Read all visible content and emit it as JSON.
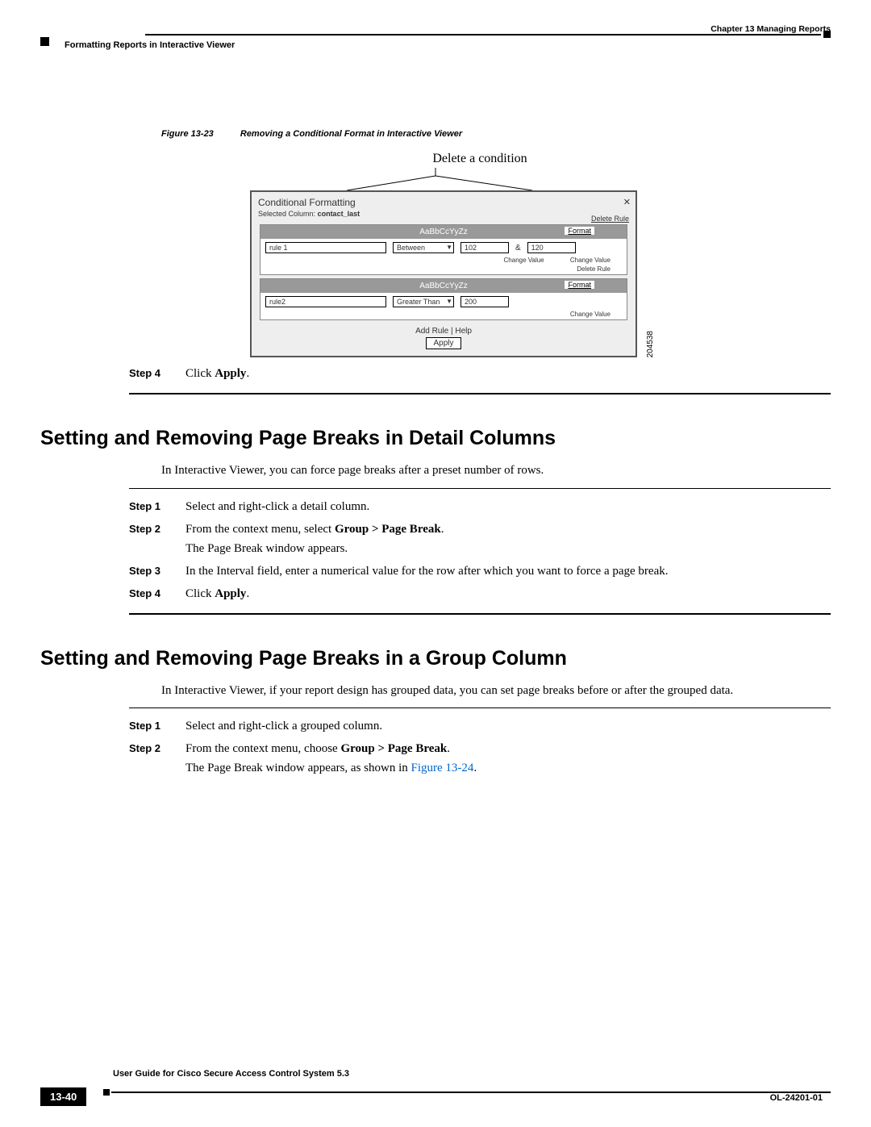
{
  "header": {
    "chapter": "Chapter 13      Managing Reports",
    "section_title": "Formatting Reports in Interactive Viewer"
  },
  "figure": {
    "number": "Figure 13-23",
    "title": "Removing a Conditional Format in Interactive Viewer",
    "callout": "Delete a condition",
    "image_id": "204538"
  },
  "dialog": {
    "title": "Conditional Formatting",
    "selected_label": "Selected Column:",
    "selected_value": "contact_last",
    "close_x": "✕",
    "delete_rule": "Delete Rule",
    "format": "Format",
    "rule1": {
      "header": "AaBbCcYyZz",
      "valueA": "rule 1",
      "op": "Between",
      "v1": "102",
      "amp": "&",
      "v2": "120",
      "cv1": "Change Value",
      "cv2": "Change Value",
      "del": "Delete Rule"
    },
    "rule2": {
      "header": "AaBbCcYyZz",
      "valueA": "rule2",
      "op": "Greater Than",
      "v1": "200",
      "cv1": "Change Value"
    },
    "footer_links": "Add Rule  |  Help",
    "apply": "Apply"
  },
  "step4_single": {
    "label": "Step 4",
    "text_a": "Click ",
    "text_b": "Apply",
    "text_c": "."
  },
  "section1": {
    "heading": "Setting and Removing Page Breaks in Detail Columns",
    "intro": "In Interactive Viewer, you can force page breaks after a preset number of rows.",
    "steps": [
      {
        "label": "Step 1",
        "text": "Select and right-click a detail column."
      },
      {
        "label": "Step 2",
        "text_a": "From the context menu, select ",
        "text_b": "Group > Page Break",
        "after": "The Page Break window appears."
      },
      {
        "label": "Step 3",
        "text": "In the Interval field, enter a numerical value for the row after which you want to force a page break."
      },
      {
        "label": "Step 4",
        "text_a": "Click ",
        "text_b": "Apply",
        "text_c": "."
      }
    ]
  },
  "section2": {
    "heading": "Setting and Removing Page Breaks in a Group Column",
    "intro": "In Interactive Viewer, if your report design has grouped data, you can set page breaks before or after the grouped data.",
    "steps": [
      {
        "label": "Step 1",
        "text": "Select and right-click a grouped column."
      },
      {
        "label": "Step 2",
        "text_a": "From the context menu, choose ",
        "text_b": "Group > Page Break",
        "after_a": "The Page Break window appears, as shown in ",
        "after_link": "Figure 13-24",
        "after_c": "."
      }
    ]
  },
  "footer": {
    "guide": "User Guide for Cisco Secure Access Control System 5.3",
    "page": "13-40",
    "doc": "OL-24201-01"
  }
}
